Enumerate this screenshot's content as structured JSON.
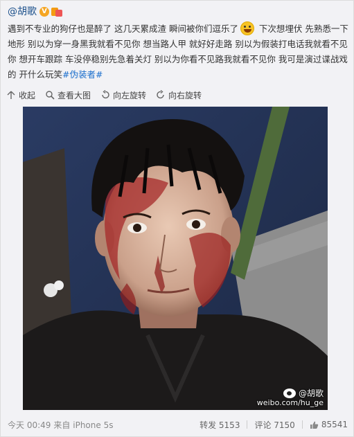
{
  "header": {
    "username": "@胡歌"
  },
  "post": {
    "text_part1": "遇到不专业的狗仔也是醉了 这几天累成渣 瞬间被你们逗乐了",
    "text_part2": " 下次想埋伏 先熟悉一下地形 别以为穿一身黑我就看不见你 想当路人甲 就好好走路 别以为假装打电话我就看不见你 想开车跟踪 车没停稳别先急着关灯 别以为你看不见路我就看不见你 我可是演过谍战戏的 开什么玩笑",
    "hashtag": "#伪装者#"
  },
  "toolbar": {
    "collapse": "收起",
    "view_large": "查看大图",
    "rotate_left": "向左旋转",
    "rotate_right": "向右旋转"
  },
  "watermark": {
    "handle": "@胡歌",
    "url": "weibo.com/hu_ge"
  },
  "footer": {
    "time": "今天 00:49",
    "source_prefix": "来自",
    "source": "iPhone 5s",
    "repost": "转发 5153",
    "comment": "评论 7150",
    "likes": "85541"
  },
  "colors": {
    "link": "#1a6ecc",
    "username": "#1a4f8a",
    "badge_v": "#f5a623"
  }
}
